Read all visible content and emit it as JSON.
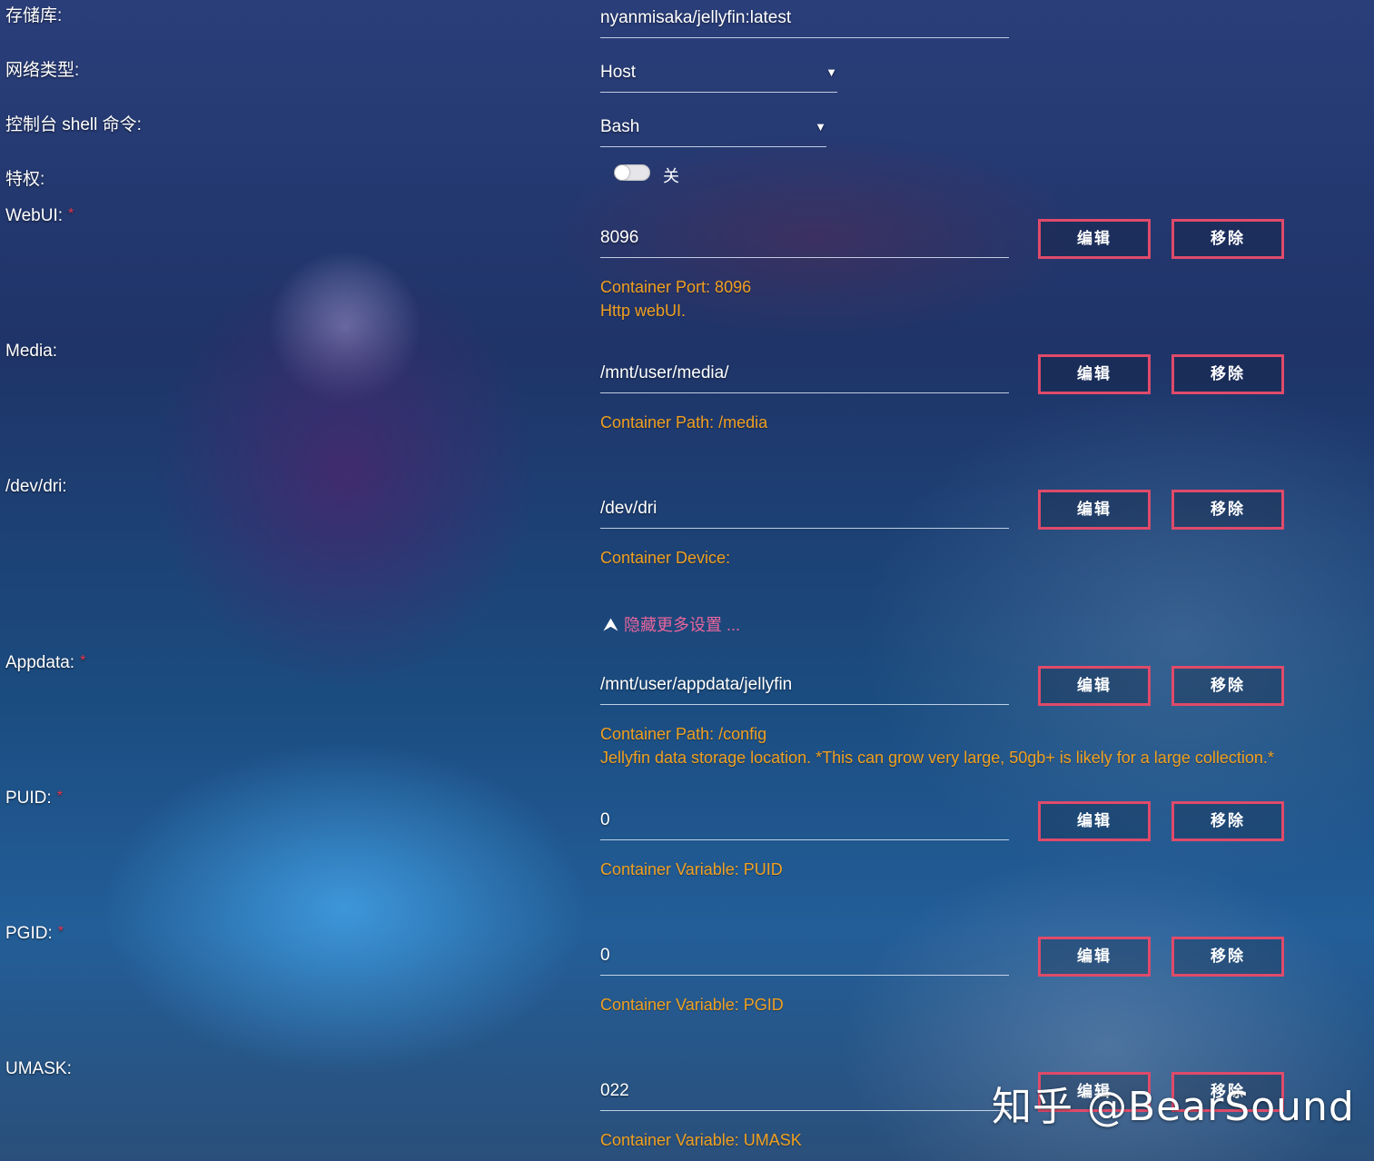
{
  "form": {
    "repository": {
      "label": "存储库:",
      "value": "nyanmisaka/jellyfin:latest"
    },
    "network_type": {
      "label": "网络类型:",
      "value": "Host"
    },
    "console_shell": {
      "label": "控制台 shell 命令:",
      "value": "Bash"
    },
    "privileged": {
      "label": "特权:",
      "state_text": "关",
      "on": false
    },
    "more_settings_link": "隐藏更多设置 ...",
    "required_marker": "*",
    "edit_label": "编辑",
    "remove_label": "移除",
    "fields": [
      {
        "label": "WebUI:",
        "required": true,
        "value": "8096",
        "hint1": "Container Port: 8096",
        "hint2": "Http webUI."
      },
      {
        "label": "Media:",
        "required": false,
        "value": "/mnt/user/media/",
        "hint1": "Container Path: /media",
        "hint2": ""
      },
      {
        "label": "/dev/dri:",
        "required": false,
        "value": "/dev/dri",
        "hint1": "Container Device:",
        "hint2": ""
      },
      {
        "label": "Appdata:",
        "required": true,
        "value": "/mnt/user/appdata/jellyfin",
        "hint1": "Container Path: /config",
        "hint2": "Jellyfin data storage location. *This can grow very large, 50gb+ is likely for a large collection.*"
      },
      {
        "label": "PUID:",
        "required": true,
        "value": "0",
        "hint1": "Container Variable: PUID",
        "hint2": ""
      },
      {
        "label": "PGID:",
        "required": true,
        "value": "0",
        "hint1": "Container Variable: PGID",
        "hint2": ""
      },
      {
        "label": "UMASK:",
        "required": false,
        "value": "022",
        "hint1": "Container Variable: UMASK",
        "hint2": ""
      }
    ]
  },
  "watermark": "知乎 @BearSound",
  "colors": {
    "button_border": "#e04a6a",
    "hint": "#f0a020",
    "link": "#e8659c",
    "required": "#e8364f"
  }
}
